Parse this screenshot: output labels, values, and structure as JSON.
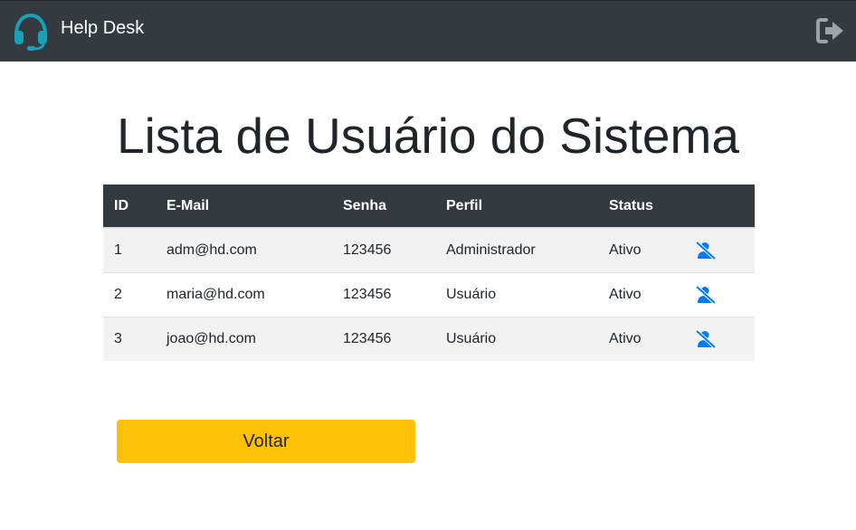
{
  "navbar": {
    "brand": "Help Desk",
    "brand_icon": "headset-icon",
    "logout_icon": "sign-out-icon"
  },
  "page": {
    "title": "Lista de Usuário do Sistema"
  },
  "table": {
    "headers": [
      "ID",
      "E-Mail",
      "Senha",
      "Perfil",
      "Status",
      ""
    ],
    "rows": [
      {
        "id": "1",
        "email": "adm@hd.com",
        "senha": "123456",
        "perfil": "Administrador",
        "status": "Ativo",
        "action_icon": "user-slash-icon"
      },
      {
        "id": "2",
        "email": "maria@hd.com",
        "senha": "123456",
        "perfil": "Usuário",
        "status": "Ativo",
        "action_icon": "user-slash-icon"
      },
      {
        "id": "3",
        "email": "joao@hd.com",
        "senha": "123456",
        "perfil": "Usuário",
        "status": "Ativo",
        "action_icon": "user-slash-icon"
      }
    ]
  },
  "actions": {
    "back_label": "Voltar"
  },
  "colors": {
    "navbar": "#343a40",
    "brand_icon": "#17a2b8",
    "action_icon": "#007bff",
    "back_button": "#ffc107",
    "logout_icon": "#9ea3a8"
  }
}
